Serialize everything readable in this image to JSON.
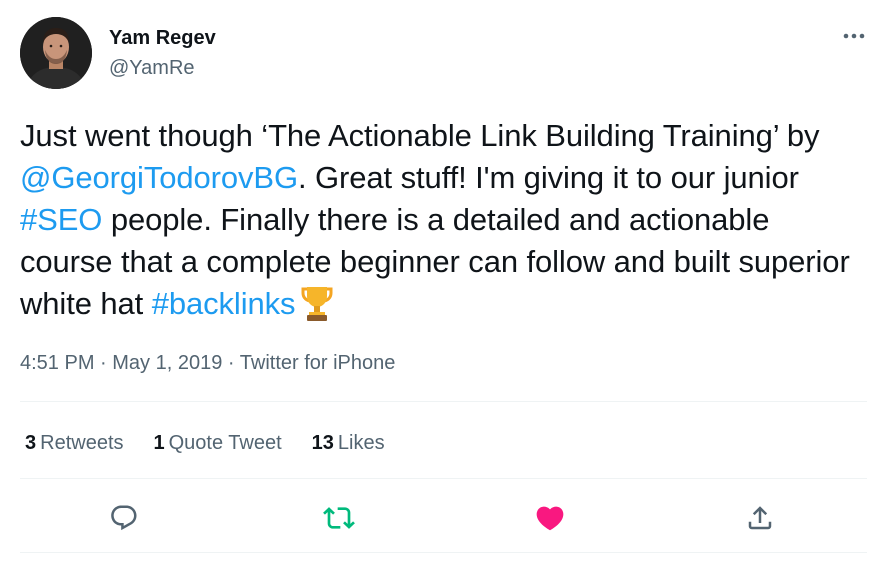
{
  "author": {
    "name": "Yam Regev",
    "handle": "@YamRe"
  },
  "tweet": {
    "seg1": "Just went though ‘The Actionable Link Building Training’ by ",
    "mention": "@GeorgiTodorovBG",
    "seg2": ". Great stuff! I'm giving it to our junior ",
    "hashtag1": "#SEO",
    "seg3": " people. Finally there is a detailed and actionable course that a complete beginner can follow and built superior white hat ",
    "hashtag2": "#backlinks",
    "emoji": "trophy-icon"
  },
  "meta": {
    "time": "4:51 PM",
    "sep1": " · ",
    "date": "May 1, 2019",
    "sep2": " · ",
    "source": "Twitter for iPhone"
  },
  "stats": {
    "retweets_count": "3",
    "retweets_label": "Retweets",
    "quotes_count": "1",
    "quotes_label": "Quote Tweet",
    "likes_count": "13",
    "likes_label": "Likes"
  },
  "actions": {
    "reply": "reply-icon",
    "retweet": "retweet-icon",
    "like": "heart-icon",
    "share": "share-icon"
  },
  "colors": {
    "link": "#1d9bf0",
    "retweet_active": "#00ba7c",
    "like_active": "#f91880",
    "secondary_text": "#536471"
  }
}
